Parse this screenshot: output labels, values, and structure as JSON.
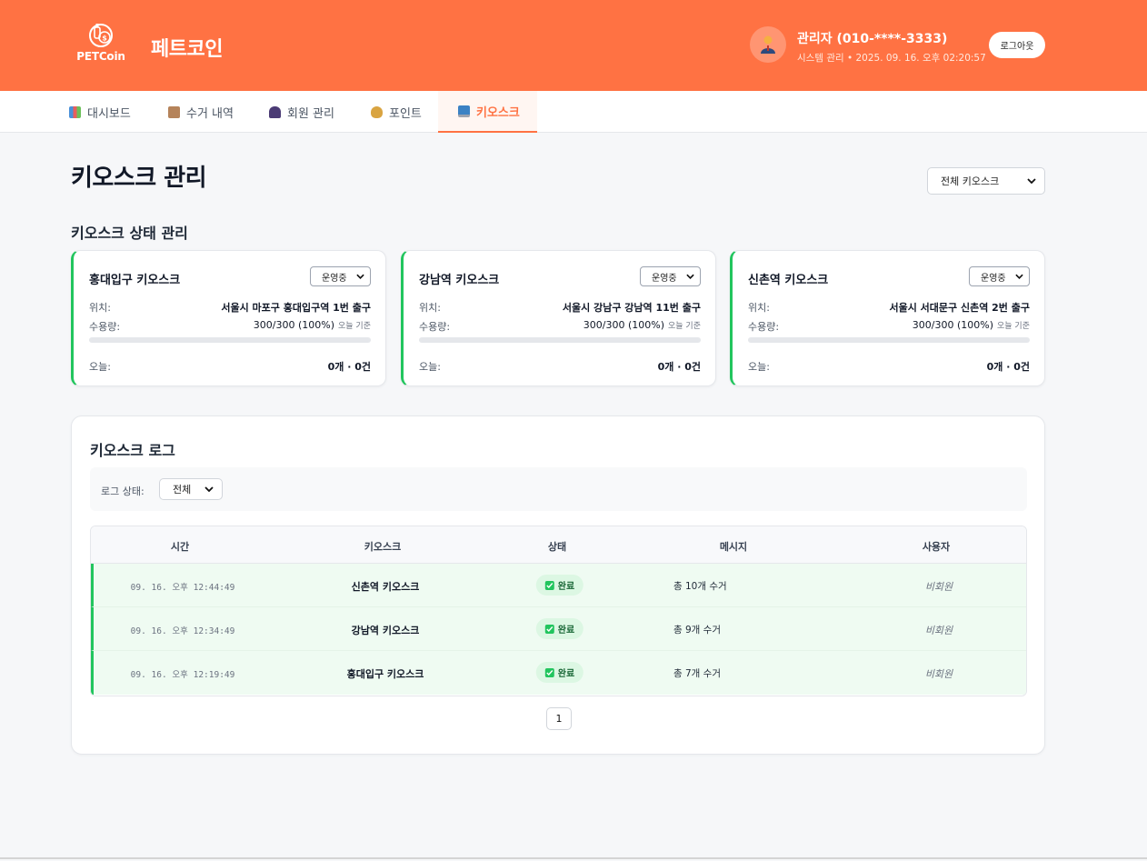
{
  "header": {
    "logo_text": "PETCoin",
    "brand": "페트코인",
    "user_name": "관리자 (010-****-3333)",
    "user_sub": "시스템 관리 • 2025. 09. 16. 오후 02:20:57",
    "logout": "로그아웃",
    "accent": "#ff7243"
  },
  "nav": {
    "tabs": [
      {
        "label": "대시보드",
        "icon": "chart-icon"
      },
      {
        "label": "수거 내역",
        "icon": "box-icon"
      },
      {
        "label": "회원 관리",
        "icon": "users-icon"
      },
      {
        "label": "포인트",
        "icon": "money-bag-icon"
      },
      {
        "label": "키오스크",
        "icon": "monitor-icon",
        "active": true
      }
    ]
  },
  "page": {
    "title": "키오스크 관리",
    "kiosk_filter": "전체 키오스크",
    "status_section_title": "키오스크 상태 관리"
  },
  "kiosks": [
    {
      "name": "홍대입구 키오스크",
      "status": "운영중",
      "location_label": "위치:",
      "location": "서울시 마포구 홍대입구역 1번 출구",
      "capacity_label": "수용량:",
      "capacity": "300/300 (100%)",
      "capacity_fraction": 1.0,
      "basis": "오늘 기준",
      "today_label": "오늘:",
      "today": "0개 · 0건"
    },
    {
      "name": "강남역 키오스크",
      "status": "운영중",
      "location_label": "위치:",
      "location": "서울시 강남구 강남역 11번 출구",
      "capacity_label": "수용량:",
      "capacity": "300/300 (100%)",
      "capacity_fraction": 1.0,
      "basis": "오늘 기준",
      "today_label": "오늘:",
      "today": "0개 · 0건"
    },
    {
      "name": "신촌역 키오스크",
      "status": "운영중",
      "location_label": "위치:",
      "location": "서울시 서대문구 신촌역 2번 출구",
      "capacity_label": "수용량:",
      "capacity": "300/300 (100%)",
      "capacity_fraction": 1.0,
      "basis": "오늘 기준",
      "today_label": "오늘:",
      "today": "0개 · 0건"
    }
  ],
  "log": {
    "title": "키오스크 로그",
    "filter_label": "로그 상태:",
    "filter_value": "전체",
    "columns": [
      "시간",
      "키오스크",
      "상태",
      "메시지",
      "사용자"
    ],
    "rows": [
      {
        "time": "09. 16. 오후 12:44:49",
        "kiosk": "신촌역 키오스크",
        "status": "완료",
        "message": "총 10개 수거",
        "user": "비회원"
      },
      {
        "time": "09. 16. 오후 12:34:49",
        "kiosk": "강남역 키오스크",
        "status": "완료",
        "message": "총 9개 수거",
        "user": "비회원"
      },
      {
        "time": "09. 16. 오후 12:19:49",
        "kiosk": "홍대입구 키오스크",
        "status": "완료",
        "message": "총 7개 수거",
        "user": "비회원"
      }
    ],
    "page": "1"
  }
}
